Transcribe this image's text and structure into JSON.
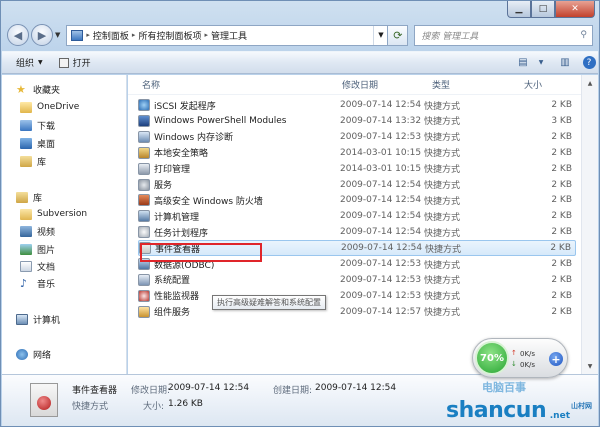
{
  "address": {
    "segments": [
      "控制面板",
      "所有控制面板项",
      "管理工具"
    ]
  },
  "search": {
    "placeholder": "搜索 管理工具"
  },
  "toolbar": {
    "organize": "组织",
    "open": "打开"
  },
  "sidebar": {
    "favorites": "收藏夹",
    "items_fav": [
      "OneDrive",
      "下载",
      "桌面",
      "库"
    ],
    "libraries": "库",
    "items_lib": [
      "Subversion",
      "视频",
      "图片",
      "文档",
      "音乐"
    ],
    "computer": "计算机",
    "network": "网络"
  },
  "columns": {
    "name": "名称",
    "date": "修改日期",
    "type": "类型",
    "size": "大小"
  },
  "files": [
    {
      "name": "iSCSI 发起程序",
      "date": "2009-07-14 12:54",
      "type": "快捷方式",
      "size": "2 KB",
      "icon": "iscsi-icon"
    },
    {
      "name": "Windows PowerShell Modules",
      "date": "2009-07-14 13:32",
      "type": "快捷方式",
      "size": "3 KB",
      "icon": "powershell-icon"
    },
    {
      "name": "Windows 内存诊断",
      "date": "2009-07-14 12:53",
      "type": "快捷方式",
      "size": "2 KB",
      "icon": "memory-diagnostic-icon"
    },
    {
      "name": "本地安全策略",
      "date": "2014-03-01 10:15",
      "type": "快捷方式",
      "size": "2 KB",
      "icon": "security-policy-icon"
    },
    {
      "name": "打印管理",
      "date": "2014-03-01 10:15",
      "type": "快捷方式",
      "size": "2 KB",
      "icon": "printer-icon"
    },
    {
      "name": "服务",
      "date": "2009-07-14 12:54",
      "type": "快捷方式",
      "size": "2 KB",
      "icon": "services-icon"
    },
    {
      "name": "高级安全 Windows 防火墙",
      "date": "2009-07-14 12:54",
      "type": "快捷方式",
      "size": "2 KB",
      "icon": "firewall-icon"
    },
    {
      "name": "计算机管理",
      "date": "2009-07-14 12:54",
      "type": "快捷方式",
      "size": "2 KB",
      "icon": "computer-management-icon"
    },
    {
      "name": "任务计划程序",
      "date": "2009-07-14 12:54",
      "type": "快捷方式",
      "size": "2 KB",
      "icon": "task-scheduler-icon"
    },
    {
      "name": "事件查看器",
      "date": "2009-07-14 12:54",
      "type": "快捷方式",
      "size": "2 KB",
      "icon": "event-viewer-icon"
    },
    {
      "name": "数据源(ODBC)",
      "date": "2009-07-14 12:53",
      "type": "快捷方式",
      "size": "2 KB",
      "icon": "odbc-icon"
    },
    {
      "name": "系统配置",
      "date": "2009-07-14 12:53",
      "type": "快捷方式",
      "size": "2 KB",
      "icon": "system-config-icon"
    },
    {
      "name": "性能监视器",
      "date": "2009-07-14 12:53",
      "type": "快捷方式",
      "size": "2 KB",
      "icon": "performance-monitor-icon"
    },
    {
      "name": "组件服务",
      "date": "2009-07-14 12:57",
      "type": "快捷方式",
      "size": "2 KB",
      "icon": "component-services-icon"
    }
  ],
  "tooltip": "执行高级疑难解答和系统配置",
  "details": {
    "name": "事件查看器",
    "modified_label": "修改日期:",
    "modified": "2009-07-14 12:54",
    "created_label": "创建日期:",
    "created": "2009-07-14 12:54",
    "type": "快捷方式",
    "size_label": "大小:",
    "size": "1.26 KB"
  },
  "widget": {
    "percent": "70%",
    "up": "0K/s",
    "down": "0K/s"
  },
  "watermark": {
    "top": "电脑百事",
    "brand": "shancun",
    "net": ".net",
    "tag": "山村网"
  }
}
